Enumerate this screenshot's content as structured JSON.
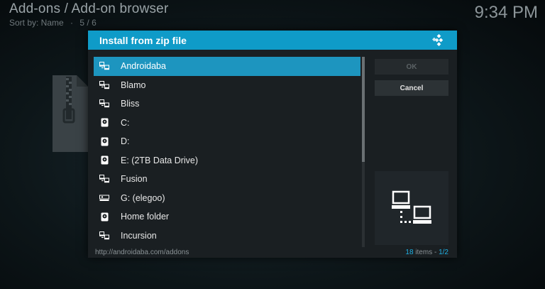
{
  "background": {
    "title": "Add-ons / Add-on browser",
    "sort_label": "Sort by: Name",
    "position": "5 / 6",
    "clock": "9:34 PM"
  },
  "dialog": {
    "title": "Install from zip file",
    "items": [
      {
        "label": "Androidaba",
        "icon": "network-share-icon",
        "selected": true
      },
      {
        "label": "Blamo",
        "icon": "network-share-icon"
      },
      {
        "label": "Bliss",
        "icon": "network-share-icon"
      },
      {
        "label": "C:",
        "icon": "hard-drive-icon"
      },
      {
        "label": "D:",
        "icon": "hard-drive-icon"
      },
      {
        "label": "E: (2TB Data Drive)",
        "icon": "hard-drive-icon"
      },
      {
        "label": "Fusion",
        "icon": "network-share-icon"
      },
      {
        "label": "G: (elegoo)",
        "icon": "optical-drive-icon"
      },
      {
        "label": "Home folder",
        "icon": "hard-drive-icon"
      },
      {
        "label": "Incursion",
        "icon": "network-share-icon"
      }
    ],
    "buttons": {
      "ok": "OK",
      "cancel": "Cancel"
    },
    "footer": {
      "path": "http://androidaba.com/addons",
      "count": "18",
      "count_suffix": " items - ",
      "page": "1/2"
    }
  },
  "colors": {
    "accent": "#0f9bc8",
    "selected_row": "#1d95bf",
    "dialog_bg": "#1a1f22"
  }
}
